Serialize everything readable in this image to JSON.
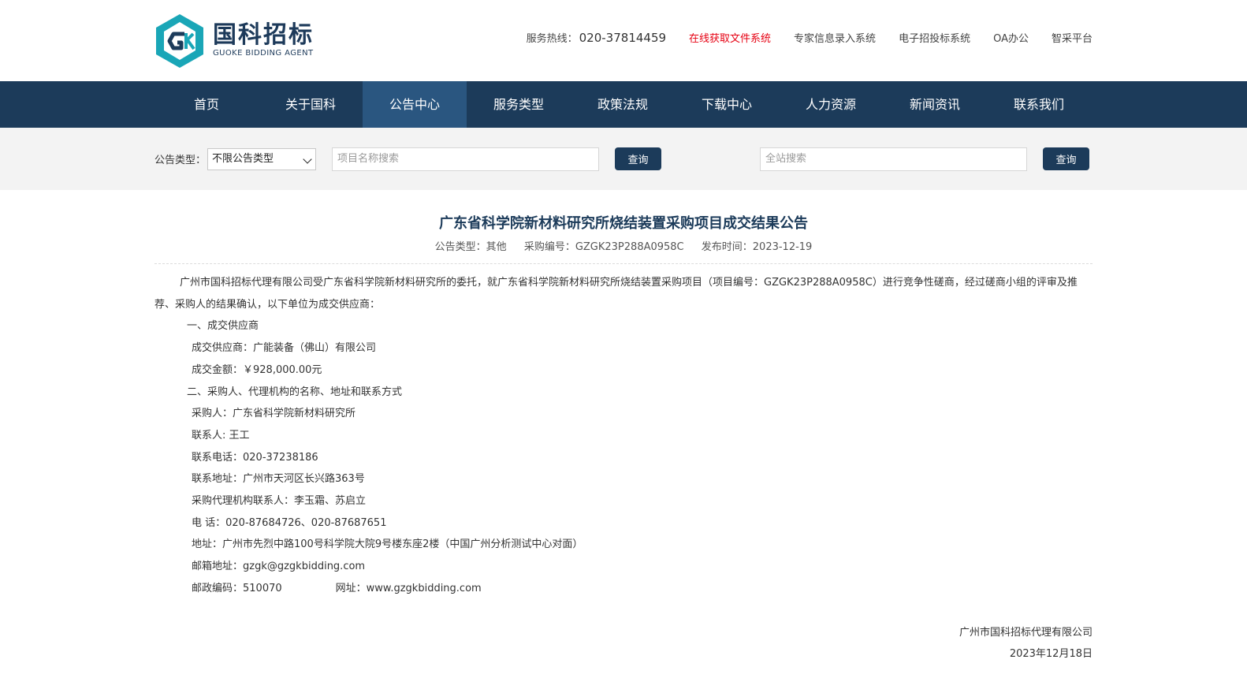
{
  "header": {
    "logo_cn": "国科招标",
    "logo_en": "GUOKE BIDDING AGENT",
    "hotline_label": "服务热线：",
    "hotline_number": "020-37814459",
    "links": [
      "在线获取文件系统",
      "专家信息录入系统",
      "电子招投标系统",
      "OA办公",
      "智采平台"
    ]
  },
  "nav": {
    "items": [
      "首页",
      "关于国科",
      "公告中心",
      "服务类型",
      "政策法规",
      "下载中心",
      "人力资源",
      "新闻资讯",
      "联系我们"
    ],
    "active_index": 2
  },
  "search": {
    "type_label": "公告类型：",
    "type_value": "不限公告类型",
    "project_placeholder": "项目名称搜索",
    "query_button": "查询",
    "site_placeholder": "全站搜索",
    "site_button": "查询"
  },
  "article": {
    "title": "广东省科学院新材料研究所烧结装置采购项目成交结果公告",
    "meta_type": "公告类型：其他",
    "meta_code": "采购编号：GZGK23P288A0958C",
    "meta_date": "发布时间：2023-12-19",
    "intro": "广州市国科招标代理有限公司受广东省科学院新材料研究所的委托，就广东省科学院新材料研究所烧结装置采购项目（项目编号：GZGK23P288A0958C）进行竞争性磋商，经过磋商小组的评审及推荐、采购人的结果确认，以下单位为成交供应商：",
    "section1": "一、成交供应商",
    "supplier": "成交供应商：广能装备（佛山）有限公司",
    "amount": "成交金额：￥928,000.00元",
    "section2": "二、采购人、代理机构的名称、地址和联系方式",
    "purchaser": "采购人：广东省科学院新材料研究所",
    "contact": "联系人: 王工",
    "phone": "联系电话：020-37238186",
    "address": "联系地址：广州市天河区长兴路363号",
    "agent_contact": "采购代理机构联系人：李玉霜、苏启立",
    "agent_phone": "电 话：020-87684726、020-87687651",
    "agent_address": "地址：广州市先烈中路100号科学院大院9号楼东座2楼（中国广州分析测试中心对面）",
    "email": "邮箱地址：gzgk@gzgkbidding.com",
    "postcode": "邮政编码：510070",
    "website": "网址：www.gzgkbidding.com",
    "sign_company": "广州市国科招标代理有限公司",
    "sign_date": "2023年12月18日"
  },
  "colors": {
    "nav_bg": "#1c3b5a",
    "nav_active": "#2a5680",
    "link_red": "#e60012",
    "logo_teal": "#1aa6b7"
  }
}
